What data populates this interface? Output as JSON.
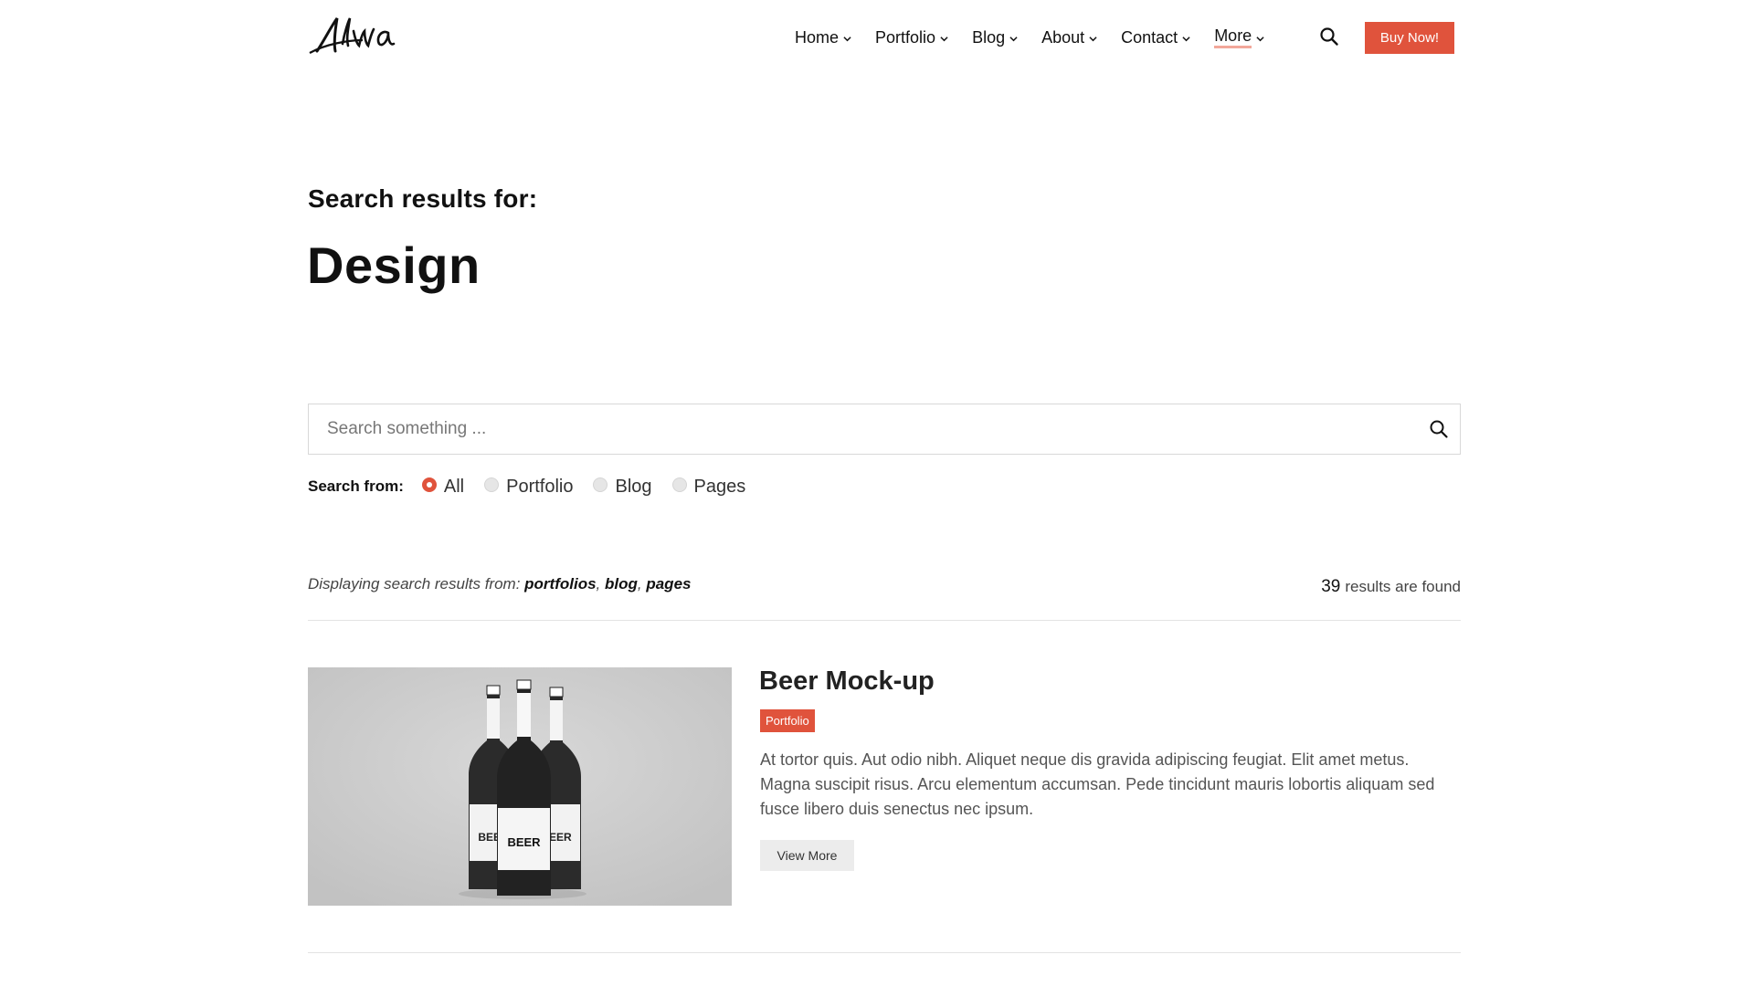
{
  "brand": {
    "logo_text": "Alva"
  },
  "nav": {
    "items": [
      {
        "label": "Home"
      },
      {
        "label": "Portfolio"
      },
      {
        "label": "Blog"
      },
      {
        "label": "About"
      },
      {
        "label": "Contact"
      },
      {
        "label": "More"
      }
    ],
    "active": "More",
    "buy_label": "Buy Now!"
  },
  "heading": {
    "subtitle": "Search results for:",
    "query": "Design"
  },
  "search": {
    "placeholder": "Search something ...",
    "value": ""
  },
  "filter": {
    "label": "Search from:",
    "options": [
      "All",
      "Portfolio",
      "Blog",
      "Pages"
    ],
    "selected": "All"
  },
  "results_info": {
    "prefix": "Displaying search results from:",
    "sources": [
      "portfolios",
      "blog",
      "pages"
    ],
    "count": "39",
    "count_suffix": "results are found"
  },
  "results": [
    {
      "title": "Beer Mock-up",
      "category": "Portfolio",
      "excerpt": "At tortor quis. Aut odio nibh. Aliquet neque dis gravida adipiscing feugiat. Elit amet metus. Magna suscipit risus. Arcu elementum accumsan. Pede tincidunt mauris lobortis aliquam sed fusce libero duis senectus nec ipsum.",
      "button_label": "View More",
      "image": {
        "label_text": "BEER"
      }
    }
  ],
  "colors": {
    "accent": "#e0533c",
    "text": "#111111",
    "muted": "#555555",
    "divider": "#e3e3e3"
  }
}
